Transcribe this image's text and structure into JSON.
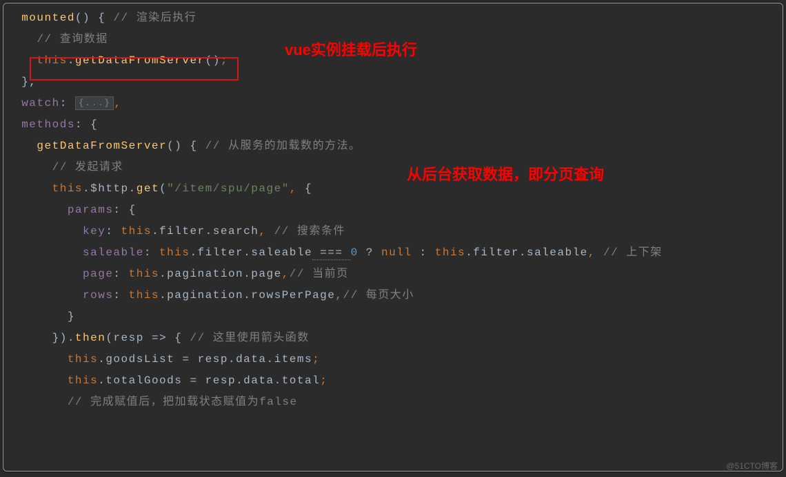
{
  "annotations": {
    "line1_annotation": "vue实例挂载后执行",
    "line2_annotation": "从后台获取数据，即分页查询"
  },
  "code": {
    "l1_kw": "mounted",
    "l1_parens": "()",
    "l1_brace": " {",
    "l1_comment": " // 渲染后执行",
    "l2_comment": "// 查询数据",
    "l3_this": "this",
    "l3_dot": ".",
    "l3_method": "getDataFromServer",
    "l3_parens": "()",
    "l3_semi": ";",
    "l4_close": "},",
    "l5_watch": "watch",
    "l5_colon": ": ",
    "l5_fold": "{...}",
    "l5_comma": ",",
    "l6_methods": "methods",
    "l6_colon": ": {",
    "l7_method": "getDataFromServer",
    "l7_parens": "()",
    "l7_brace": " {",
    "l7_comment": " // 从服务的加载数的方法。",
    "l8_comment": "// 发起请求",
    "l9_this": "this",
    "l9_dot1": ".",
    "l9_http": "$http",
    "l9_dot2": ".",
    "l9_get": "get",
    "l9_paren": "(",
    "l9_string": "\"/item/spu/page\"",
    "l9_comma": ",",
    "l9_brace": " {",
    "l10_params": "params",
    "l10_colon": ": {",
    "l11_key": "key",
    "l11_colon": ": ",
    "l11_this": "this",
    "l11_dot1": ".",
    "l11_filter": "filter",
    "l11_dot2": ".",
    "l11_search": "search",
    "l11_comma": ",",
    "l11_comment": " // 搜索条件",
    "l12_saleable": "saleable",
    "l12_colon": ": ",
    "l12_this1": "this",
    "l12_dot1": ".",
    "l12_filter1": "filter",
    "l12_dot2": ".",
    "l12_sale1": "saleable",
    "l12_eq": " === ",
    "l12_zero": "0",
    "l12_q": " ? ",
    "l12_null": "null",
    "l12_c": " : ",
    "l12_this2": "this",
    "l12_dot3": ".",
    "l12_filter2": "filter",
    "l12_dot4": ".",
    "l12_sale2": "saleable",
    "l12_comma": ",",
    "l12_comment": " // 上下架",
    "l13_page": "page",
    "l13_colon": ": ",
    "l13_this": "this",
    "l13_dot1": ".",
    "l13_pag": "pagination",
    "l13_dot2": ".",
    "l13_page2": "page",
    "l13_comma": ",",
    "l13_comment": "// 当前页",
    "l14_rows": "rows",
    "l14_colon": ": ",
    "l14_this": "this",
    "l14_dot1": ".",
    "l14_pag": "pagination",
    "l14_dot2": ".",
    "l14_rpp": "rowsPerPage",
    "l14_comma": ",",
    "l14_comment": "// 每页大小",
    "l15_close": "}",
    "l16_close": "})",
    "l16_dot": ".",
    "l16_then": "then",
    "l16_paren": "(",
    "l16_resp": "resp",
    "l16_arrow": " => ",
    "l16_brace": "{",
    "l16_comment": " // 这里使用箭头函数",
    "l17_this": "this",
    "l17_dot1": ".",
    "l17_goods": "goodsList",
    "l17_eq": " = ",
    "l17_resp": "resp",
    "l17_dot2": ".",
    "l17_data": "data",
    "l17_dot3": ".",
    "l17_items": "items",
    "l17_semi": ";",
    "l18_this": "this",
    "l18_dot1": ".",
    "l18_total": "totalGoods",
    "l18_eq": " = ",
    "l18_resp": "resp",
    "l18_dot2": ".",
    "l18_data": "data",
    "l18_dot3": ".",
    "l18_total2": "total",
    "l18_semi": ";",
    "l19_comment": "// 完成赋值后，把加载状态赋值为false"
  },
  "watermark": "@51CTO博客"
}
